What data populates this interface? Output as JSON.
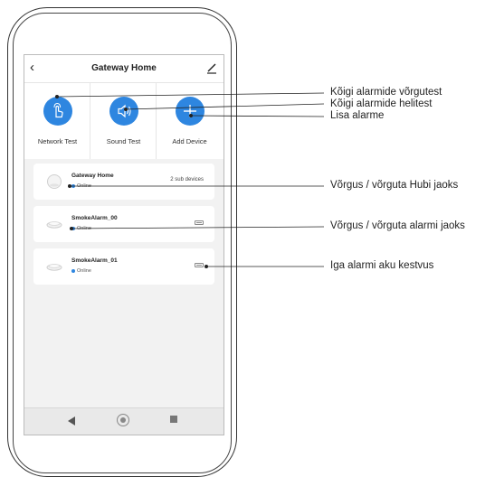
{
  "phone": {
    "title": "Gateway Home",
    "back_icon": "chevron-left-icon",
    "edit_icon": "pencil-icon",
    "actions": [
      {
        "label": "Network Test",
        "icon": "hand-tap-icon"
      },
      {
        "label": "Sound Test",
        "icon": "speaker-icon"
      },
      {
        "label": "Add Device",
        "icon": "plus-icon"
      }
    ],
    "devices": [
      {
        "name": "Gateway Home",
        "status": "Online",
        "sub": "2 sub devices"
      },
      {
        "name": "SmokeAlarm_00",
        "status": "Online"
      },
      {
        "name": "SmokeAlarm_01",
        "status": "Online"
      }
    ],
    "nav": [
      "back-triangle-icon",
      "home-circle-icon",
      "recent-square-icon"
    ],
    "accent_color": "#2e86e0"
  },
  "callouts": [
    "Kõigi alarmide võrgutest",
    "Kõigi alarmide helitest",
    "Lisa alarme",
    "Võrgus / võrguta Hubi jaoks",
    "Võrgus / võrguta alarmi jaoks",
    "Iga alarmi aku kestvus"
  ]
}
